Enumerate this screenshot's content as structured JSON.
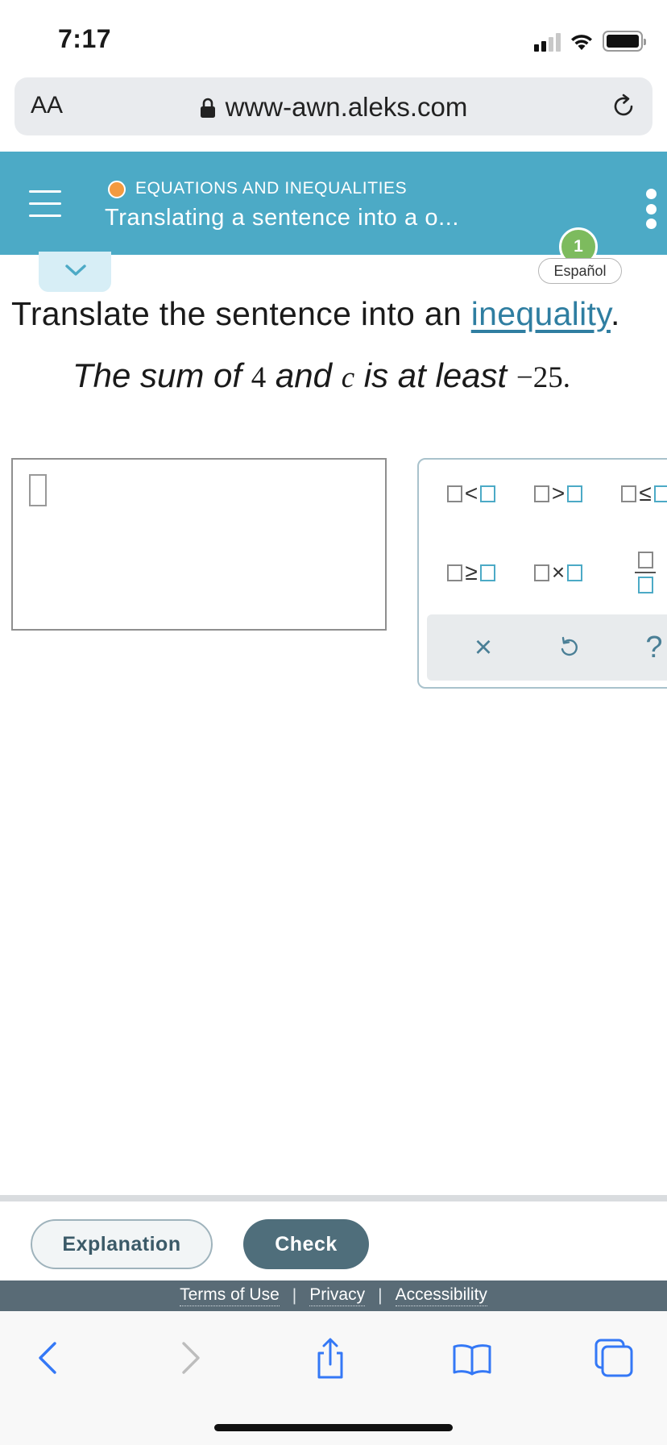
{
  "status_bar": {
    "time": "7:17",
    "signal_bars": 4,
    "signal_active_bars": 2
  },
  "browser": {
    "text_size_label": "AA",
    "url": "www-awn.aleks.com"
  },
  "header": {
    "category": "EQUATIONS AND INEQUALITIES",
    "title": "Translating a sentence into a o..."
  },
  "progress_badge": "1",
  "language_button": "Español",
  "question": {
    "prompt_text": "Translate the sentence into an ",
    "prompt_link": "inequality",
    "prompt_end": ".",
    "sentence_1": "The sum of ",
    "num_a": "4",
    "sentence_2": " and ",
    "var_c": "c",
    "sentence_3": " is at least ",
    "num_b": "−25."
  },
  "keypad": {
    "keys": [
      {
        "name": "less-than",
        "op": "<"
      },
      {
        "name": "greater-than",
        "op": ">"
      },
      {
        "name": "less-equal",
        "op": "≤"
      },
      {
        "name": "greater-equal",
        "op": "≥"
      },
      {
        "name": "times",
        "op": "×"
      }
    ],
    "actions": {
      "clear": "×",
      "help": "?"
    },
    "colors": {
      "placeholder_accent": "#4caac6",
      "action_icon": "#4a7f96"
    }
  },
  "footer": {
    "explanation_label": "Explanation",
    "check_label": "Check",
    "terms_label": "Terms of Use",
    "privacy_label": "Privacy",
    "accessibility_label": "Accessibility",
    "separator": "|"
  },
  "colors": {
    "header_bg": "#4caac6",
    "category_dot": "#f39a3f",
    "badge_bg": "#7dbb5e",
    "check_bg": "#4f6e7b",
    "legal_bg": "#596b76",
    "link": "#2f7ea1",
    "safari_blue": "#3478f6"
  }
}
